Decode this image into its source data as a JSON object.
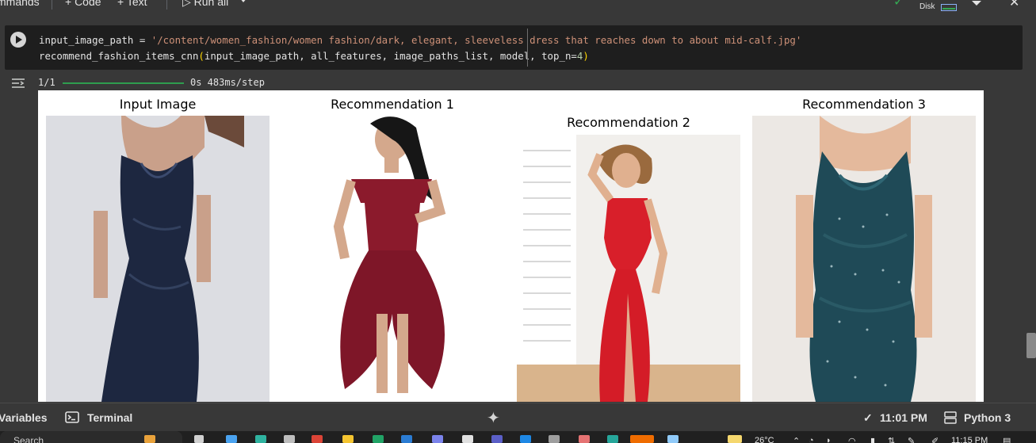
{
  "toolbar": {
    "commands_label": "mmands",
    "code_label": "+ Code",
    "text_label": "+ Text",
    "run_all_label": "▷ Run all",
    "disk_label": "Disk"
  },
  "cell": {
    "line1_var": "input_image_path = ",
    "line1_str": "'/content/women_fashion/women fashion/dark, elegant, sleeveless dress that reaches down to about mid-calf.jpg'",
    "line2_fn": "recommend_fashion_items_cnn",
    "line2_args": "input_image_path, all_features, image_paths_list, model, top_n=",
    "line2_n": "4"
  },
  "output": {
    "step_count": "1/1",
    "step_timing": "0s 483ms/step",
    "figure": {
      "titles": [
        "Input Image",
        "Recommendation 1",
        "Recommendation 2",
        "Recommendation 3"
      ]
    }
  },
  "statusbar": {
    "variables_label": "Variables",
    "terminal_label": "Terminal",
    "time_label": "11:01 PM",
    "runtime_label": "Python 3"
  },
  "taskbar": {
    "search_placeholder": "Search",
    "weather": "26°C",
    "clock": "11:15 PM"
  },
  "colors": {
    "accent_green": "#34a853",
    "string_orange": "#ce9178"
  }
}
